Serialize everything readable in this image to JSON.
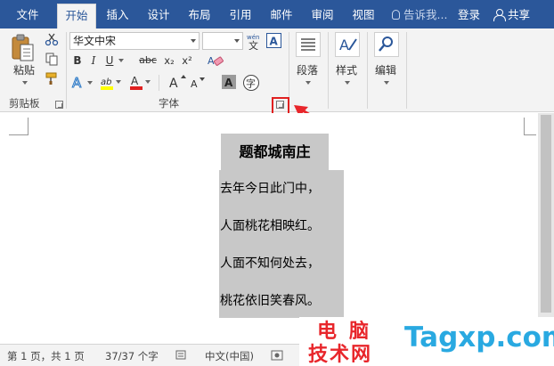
{
  "menubar": {
    "tabs": [
      {
        "label": "文件"
      },
      {
        "label": "开始"
      },
      {
        "label": "插入"
      },
      {
        "label": "设计"
      },
      {
        "label": "布局"
      },
      {
        "label": "引用"
      },
      {
        "label": "邮件"
      },
      {
        "label": "审阅"
      },
      {
        "label": "视图"
      }
    ],
    "tell_me": "告诉我...",
    "login": "登录",
    "share": "共享"
  },
  "ribbon": {
    "clipboard": {
      "paste_label": "粘贴",
      "group_label": "剪贴板"
    },
    "font": {
      "font_name": "华文中宋",
      "font_size": "",
      "bold": "B",
      "italic": "I",
      "underline": "U",
      "strike": "abc",
      "subscript": "x₂",
      "superscript": "x²",
      "grow": "A",
      "shrink": "A",
      "group_label": "字体"
    },
    "paragraph_label": "段落",
    "styles_label": "样式",
    "editing_label": "编辑"
  },
  "document": {
    "title": "题都城南庄",
    "lines": [
      "去年今日此门中，",
      "人面桃花相映红。",
      "人面不知何处去，",
      "桃花依旧笑春风。"
    ]
  },
  "statusbar": {
    "page": "第 1 页，共 1 页",
    "words": "37/37 个字",
    "language": "中文(中国)"
  },
  "watermark": {
    "cn_top": "电脑",
    "cn_bottom": "技术网",
    "en": "Tagxp.com"
  },
  "colors": {
    "titlebar": "#2b579a",
    "highlight_frame": "#e02020",
    "watermark_red": "#e8262b",
    "watermark_blue": "#29a9e1"
  }
}
